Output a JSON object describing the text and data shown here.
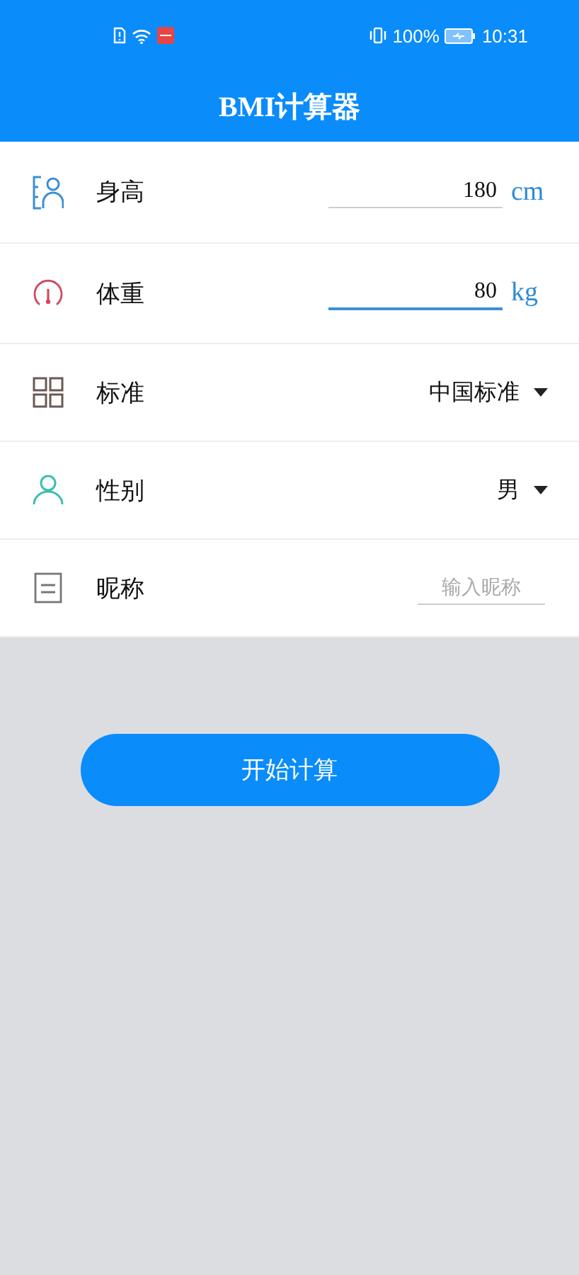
{
  "status_bar": {
    "battery_text": "100%",
    "time": "10:31"
  },
  "title": "BMI计算器",
  "rows": [
    {
      "kind": "input",
      "label": "身高",
      "value": "180",
      "unit": "cm",
      "focused": false
    },
    {
      "kind": "input",
      "label": "体重",
      "value": "80",
      "unit": "kg",
      "focused": true
    },
    {
      "kind": "select",
      "label": "标准",
      "value": "中国标准"
    },
    {
      "kind": "select",
      "label": "性别",
      "value": "男"
    },
    {
      "kind": "text",
      "label": "昵称",
      "placeholder": "输入昵称"
    }
  ],
  "button": "开始计算"
}
